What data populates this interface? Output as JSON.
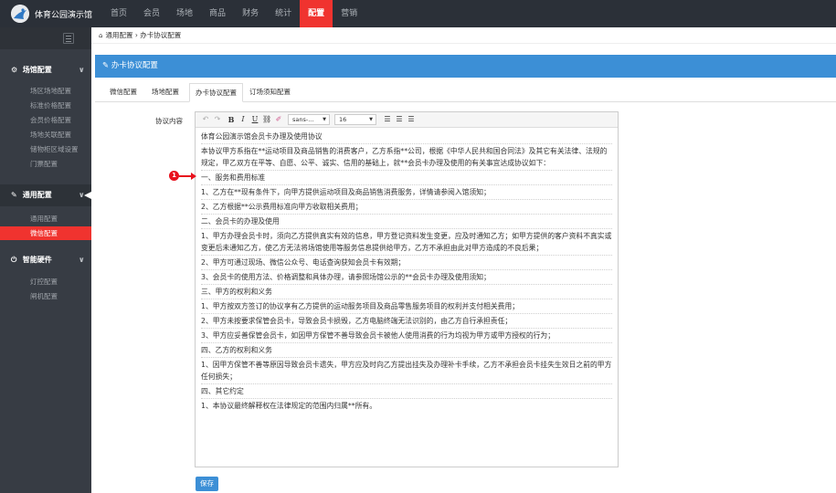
{
  "app": {
    "title": "体育公园演示馆"
  },
  "top_nav": [
    {
      "label": "首页"
    },
    {
      "label": "会员"
    },
    {
      "label": "场地"
    },
    {
      "label": "商品"
    },
    {
      "label": "财务"
    },
    {
      "label": "统计"
    },
    {
      "label": "配置",
      "active": true
    },
    {
      "label": "营销"
    }
  ],
  "sidebar": {
    "groups": [
      {
        "icon": "cogs-icon",
        "label": "场馆配置",
        "items": [
          "场区场地配置",
          "标准价格配置",
          "会员价格配置",
          "场地关联配置",
          "储物柜区域设置",
          "门票配置"
        ]
      },
      {
        "icon": "wrench-icon",
        "label": "通用配置",
        "items": [
          "通用配置",
          "微信配置"
        ],
        "active_item": "微信配置"
      },
      {
        "icon": "power-icon",
        "label": "智能硬件",
        "items": [
          "灯控配置",
          "闸机配置"
        ]
      }
    ]
  },
  "breadcrumb": {
    "home_icon": "home-icon",
    "text": "通用配置 › 办卡协议配置"
  },
  "panel": {
    "title": "办卡协议配置",
    "icon": "edit-icon"
  },
  "tabs": [
    {
      "label": "微信配置"
    },
    {
      "label": "场地配置"
    },
    {
      "label": "办卡协议配置",
      "active": true
    },
    {
      "label": "订场须知配置"
    }
  ],
  "form": {
    "label": "协议内容",
    "save_label": "保存"
  },
  "toolbar": {
    "undo": "↶",
    "redo": "↷",
    "bold": "B",
    "italic": "I",
    "underline": "U",
    "link": "⛓",
    "eraser": "✐",
    "font_family": "sans-...",
    "font_size": "16",
    "list_ul": "☰",
    "list_ol": "☰",
    "align": "☰"
  },
  "annotation": {
    "number": "1"
  },
  "agreement": {
    "paragraphs": [
      "体育公园演示馆会员卡办理及使用协议",
      "本协议甲方系指在**运动项目及商品销售的消费客户，乙方系指**公司，根据《中华人民共和国合同法》及其它有关法律、法规的规定，甲乙双方在平等、自愿、公平、诚实、信用的基础上，就**会员卡办理及使用的有关事宜达成协议如下：",
      "一、服务和费用标准",
      "1、乙方在**现有条件下，向甲方提供运动项目及商品销售消费服务，详情请参阅入馆须知；",
      "2、乙方根据**公示费用标准向甲方收取相关费用；",
      "二、会员卡的办理及使用",
      "1、甲方办理会员卡时，须向乙方提供真实有效的信息，甲方登记资料发生变更，应及时通知乙方；如甲方提供的客户资料不真实或变更后未通知乙方，使乙方无法将场馆使用等服务信息提供给甲方，乙方不承担由此对甲方造成的不良后果；",
      "2、甲方可通过现场、微信公众号、电话查询获知会员卡有效期；",
      "3、会员卡的使用方法、价格调整和具体办理，请参照场馆公示的**会员卡办理及使用须知；",
      "三、甲方的权利和义务",
      "1、甲方按双方签订的协议享有乙方提供的运动服务项目及商品零售服务项目的权利并支付相关费用；",
      "2、甲方未按要求保管会员卡，导致会员卡损毁，乙方电脑终端无法识别的，由乙方自行承担责任；",
      "3、甲方应妥善保管会员卡，如因甲方保管不善导致会员卡被他人使用消费的行为均视为甲方或甲方授权的行为；",
      "四、乙方的权利和义务",
      "1、因甲方保管不善等原因导致会员卡遗失，甲方应及时向乙方提出挂失及办理补卡手续，乙方不承担会员卡挂失生效日之前的甲方任何损失；",
      "四、其它约定",
      "1、本协议最终解释权在法律规定的范围内归属**所有。"
    ]
  }
}
